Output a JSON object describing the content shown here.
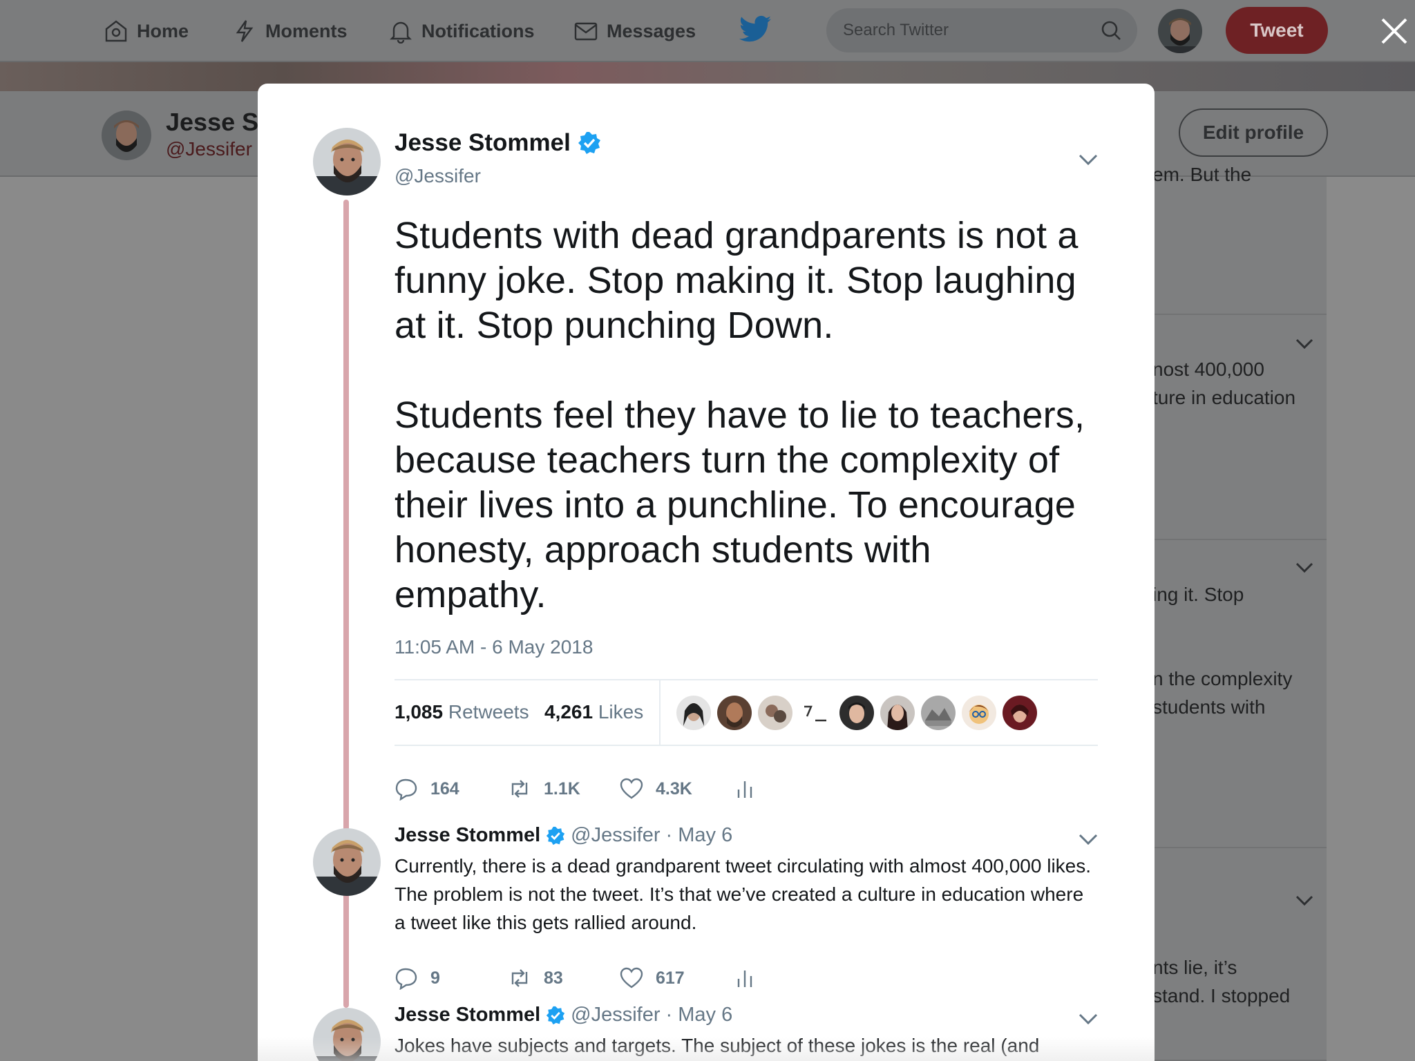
{
  "nav": {
    "home": "Home",
    "moments": "Moments",
    "notifications": "Notifications",
    "messages": "Messages",
    "search_placeholder": "Search Twitter",
    "tweet_button": "Tweet"
  },
  "profile": {
    "name_partial": "Jesse S",
    "handle": "@Jessifer",
    "edit_profile": "Edit profile"
  },
  "background_timeline": {
    "fragments": [
      "em. But the",
      "nost 400,000",
      "ture in education",
      "ing it. Stop",
      "n the complexity",
      "students with",
      "nts lie, it’s",
      "stand. I stopped"
    ]
  },
  "main_tweet": {
    "name": "Jesse Stommel",
    "handle": "@Jessifer",
    "paragraphs": [
      "Students with dead grandparents is not a funny joke. Stop making it. Stop laughing at it. Stop punching Down.",
      "Students feel they have to lie to teachers, because teachers turn the complexity of their lives into a punchline. To encourage honesty, approach students with empathy."
    ],
    "timestamp": "11:05 AM - 6 May 2018",
    "retweets_count": "1,085",
    "retweets_label": "Retweets",
    "likes_count": "4,261",
    "likes_label": "Likes",
    "reply_count": "164",
    "retweet_count_short": "1.1K",
    "like_count_short": "4.3K"
  },
  "replies": [
    {
      "name": "Jesse Stommel",
      "handle": "@Jessifer",
      "date": "· May 6",
      "text": "Currently, there is a dead grandparent tweet circulating with almost 400,000 likes. The problem is not the tweet. It’s that we’ve created a culture in education where a tweet like this gets rallied around.",
      "replies": "9",
      "retweets": "83",
      "likes": "617"
    },
    {
      "name": "Jesse Stommel",
      "handle": "@Jessifer",
      "date": "· May 6",
      "text": "Jokes have subjects and targets. The subject of these jokes is the real (and"
    }
  ],
  "colors": {
    "accent_blue": "#1da1f2",
    "thread_line": "#d8a5ab",
    "tweet_button": "#6e2124",
    "muted_text": "#657786"
  }
}
